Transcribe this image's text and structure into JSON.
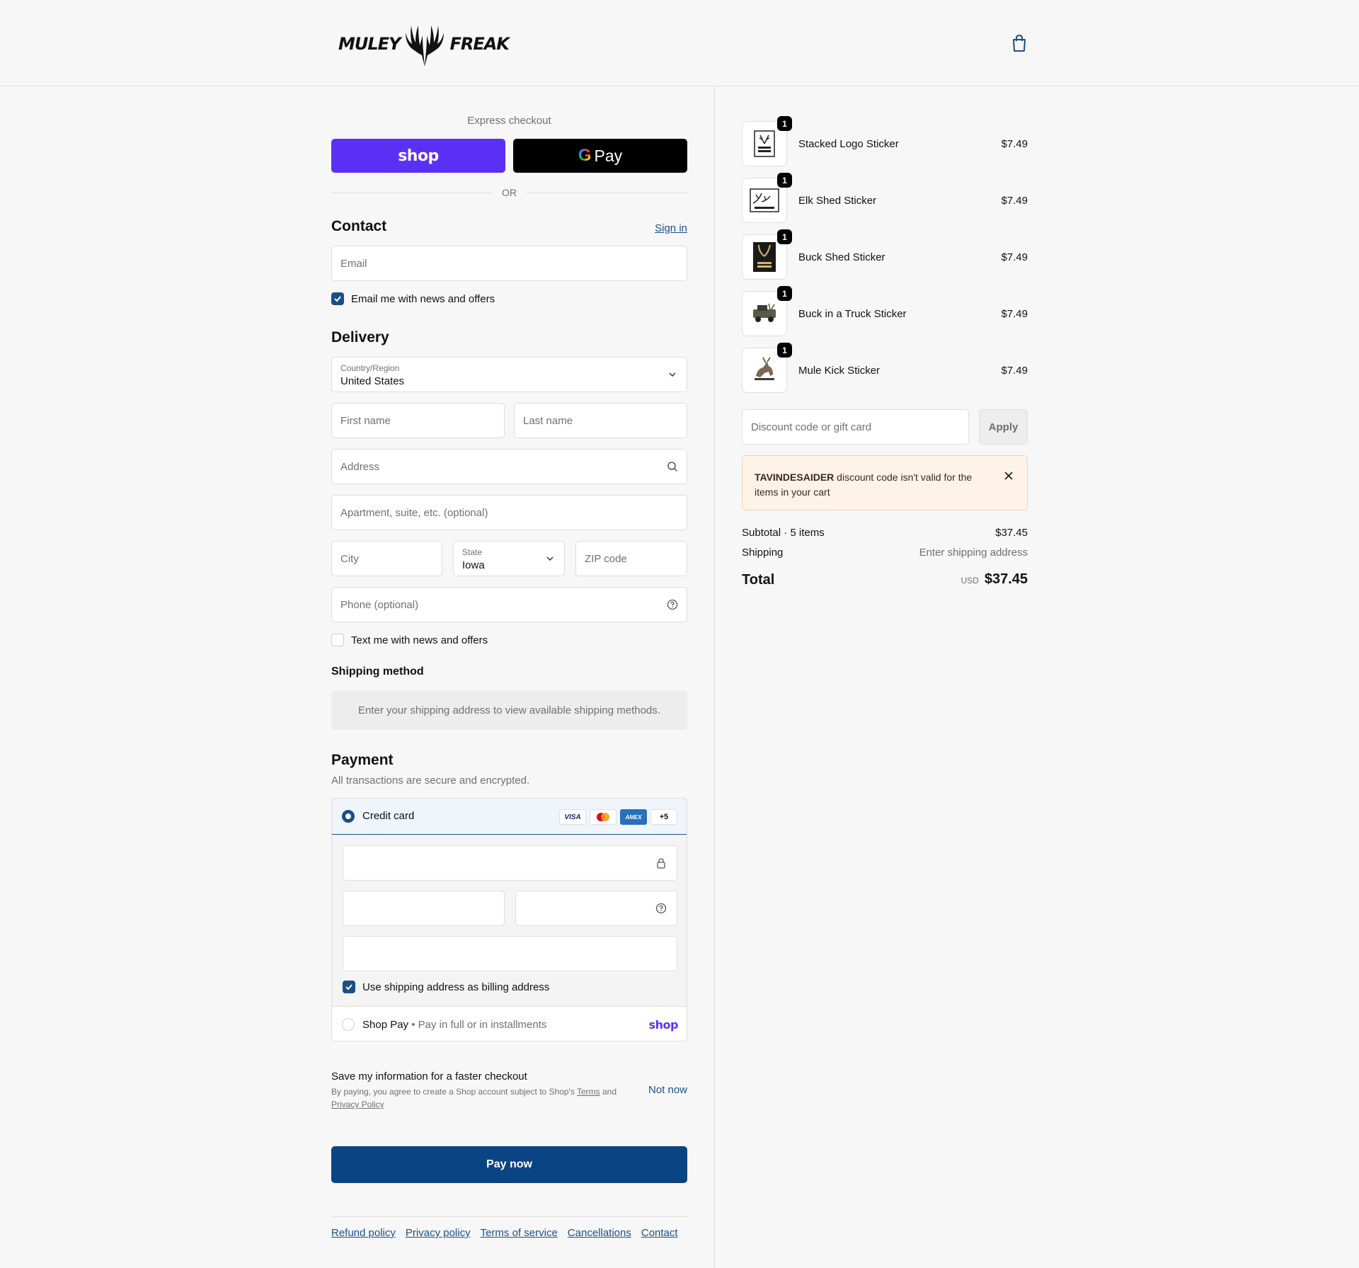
{
  "header": {
    "logo_left": "MULEY",
    "logo_right": "FREAK"
  },
  "express": {
    "title": "Express checkout",
    "shop_label": "shop",
    "gpay_label": "Pay",
    "or_label": "OR"
  },
  "contact": {
    "title": "Contact",
    "signin": "Sign in",
    "email_placeholder": "Email",
    "news_label": "Email me with news and offers",
    "news_checked": true
  },
  "delivery": {
    "title": "Delivery",
    "country_label": "Country/Region",
    "country_value": "United States",
    "first_name": "First name",
    "last_name": "Last name",
    "address": "Address",
    "apartment": "Apartment, suite, etc. (optional)",
    "city": "City",
    "state_label": "State",
    "state_value": "Iowa",
    "zip": "ZIP code",
    "phone": "Phone (optional)",
    "text_label": "Text me with news and offers",
    "text_checked": false
  },
  "shipping_method": {
    "title": "Shipping method",
    "info": "Enter your shipping address to view available shipping methods."
  },
  "payment": {
    "title": "Payment",
    "subtitle": "All transactions are secure and encrypted.",
    "credit_card_label": "Credit card",
    "brands": [
      "VISA",
      "MC",
      "AMEX",
      "+5"
    ],
    "billing_label": "Use shipping address as billing address",
    "billing_checked": true,
    "shop_pay_label": "Shop Pay",
    "shop_pay_sub": "Pay in full or in installments",
    "shop_pay_logo": "shop"
  },
  "save_info": {
    "title": "Save my information for a faster checkout",
    "text_before": "By paying, you agree to create a Shop account subject to Shop's",
    "terms": "Terms",
    "and": "and",
    "privacy": "Privacy Policy",
    "not_now": "Not now"
  },
  "pay_now": "Pay now",
  "footer_links": [
    "Refund policy",
    "Privacy policy",
    "Terms of service",
    "Cancellations",
    "Contact"
  ],
  "cart": {
    "items": [
      {
        "name": "Stacked Logo Sticker",
        "price": "$7.49",
        "qty": "1"
      },
      {
        "name": "Elk Shed Sticker",
        "price": "$7.49",
        "qty": "1"
      },
      {
        "name": "Buck Shed Sticker",
        "price": "$7.49",
        "qty": "1"
      },
      {
        "name": "Buck in a Truck Sticker",
        "price": "$7.49",
        "qty": "1"
      },
      {
        "name": "Mule Kick Sticker",
        "price": "$7.49",
        "qty": "1"
      }
    ],
    "discount_placeholder": "Discount code or gift card",
    "apply": "Apply",
    "alert_code": "TAVINDESAIDER",
    "alert_text": " discount code isn't valid for the items in your cart",
    "subtotal_label": "Subtotal · 5 items",
    "subtotal_value": "$37.45",
    "shipping_label": "Shipping",
    "shipping_value": "Enter shipping address",
    "total_label": "Total",
    "currency": "USD",
    "total_value": "$37.45"
  }
}
